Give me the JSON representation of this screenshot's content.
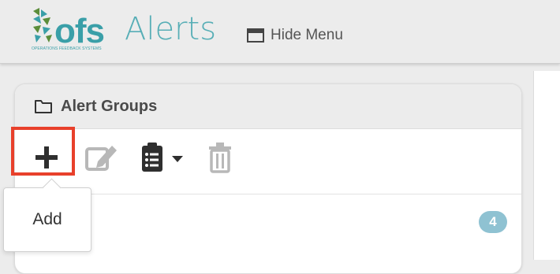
{
  "header": {
    "logo_text": "ofs",
    "logo_tagline": "OPERATIONS FEEDBACK SYSTEMS",
    "app_title": "Alerts",
    "hide_menu_label": "Hide Menu"
  },
  "panel": {
    "title": "Alert Groups",
    "toolbar": [
      "add",
      "edit",
      "list-menu",
      "delete"
    ],
    "group_count": "4"
  },
  "tooltip": {
    "text": "Add"
  },
  "colors": {
    "brand": "#3a9fa8",
    "highlight": "#e8402b",
    "badge": "#8fc2d2"
  }
}
